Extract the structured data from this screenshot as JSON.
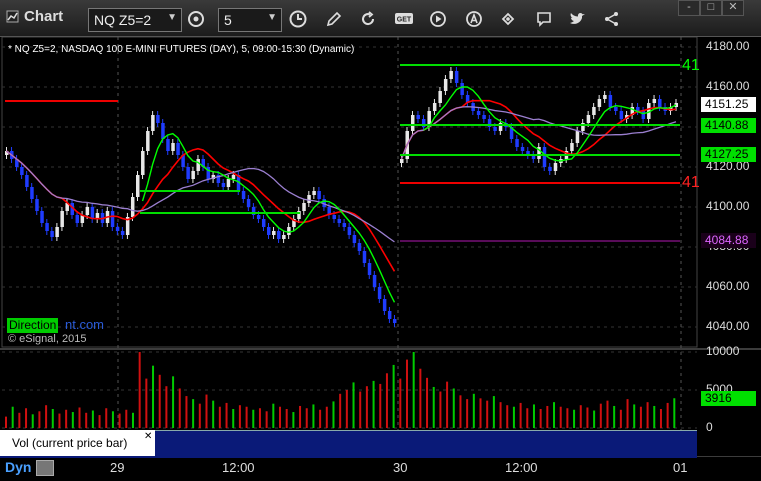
{
  "window": {
    "title": "Chart"
  },
  "toolbar": {
    "symbol": "NQ Z5=2",
    "interval": "5",
    "icons": [
      "settings-icon",
      "clock-icon",
      "draw-pencil-icon",
      "refresh-icon",
      "get-icon",
      "play-icon",
      "font-icon",
      "link-icon",
      "chat-icon",
      "twitter-icon",
      "share-icon"
    ]
  },
  "window_controls": {
    "minimize": "-",
    "maximize": "□",
    "close": "✕"
  },
  "chart_header": "* NQ Z5=2, NASDAQ 100 E-MINI FUTURES (DAY), 5, 09:00-15:30 (Dynamic)",
  "price_axis": [
    "4180.00",
    "4160.00",
    "4140.00",
    "4120.00",
    "4100.00",
    "4080.00",
    "4060.00",
    "4040.00"
  ],
  "price_tags": [
    {
      "text": "4151.25",
      "bg": "#ffffff",
      "fg": "#000000"
    },
    {
      "text": "4140.88",
      "bg": "#00e000",
      "fg": "#000000"
    },
    {
      "text": "4127.25",
      "bg": "#00e000",
      "fg": "#000000"
    },
    {
      "text": "4084.88",
      "bg": "#1a001a",
      "fg": "#dd66ff"
    }
  ],
  "line_labels": [
    {
      "text": "41",
      "color": "#00ff00"
    },
    {
      "text": "41",
      "color": "#ff2020"
    }
  ],
  "volume_axis": [
    "10000",
    "5000",
    "0"
  ],
  "volume_tag": "3916",
  "time_axis": [
    "29",
    "12:00",
    "30",
    "12:00",
    "01"
  ],
  "direction_badge": "Direction",
  "direction_url": "nt.com",
  "copyright": "© eSignal, 2015",
  "volume_study": "Vol (current price bar)",
  "volume_close": "✕",
  "dyn_label": "Dyn",
  "colors": {
    "up": "#e8e8e8",
    "down": "#1f3cff",
    "red_line": "#ff0000",
    "green_line": "#00ff00",
    "purple_line": "#9b7fd0"
  },
  "chart_data": {
    "type": "candlestick",
    "ylim": [
      4030,
      4185
    ],
    "sessions": [
      {
        "label": "29",
        "closes": [
          4128,
          4124,
          4120,
          4116,
          4110,
          4104,
          4098,
          4092,
          4088,
          4085,
          4090,
          4098,
          4102,
          4096,
          4092,
          4096,
          4100,
          4094,
          4097,
          4092,
          4098,
          4090,
          4088,
          4086,
          4095,
          4105,
          4116,
          4128,
          4138,
          4146,
          4142,
          4134,
          4128,
          4132,
          4126,
          4120,
          4114,
          4118,
          4124,
          4120,
          4114,
          4116,
          4112,
          4110,
          4114,
          4116,
          4108,
          4104,
          4100,
          4096,
          4094,
          4090,
          4086,
          4088,
          4084,
          4086,
          4090,
          4094,
          4098,
          4102,
          4106,
          4108,
          4104,
          4100,
          4096,
          4094,
          4092,
          4090,
          4086,
          4082,
          4078,
          4072,
          4066,
          4060,
          4054,
          4048,
          4044,
          4042
        ]
      },
      {
        "label": "30",
        "closes": [
          4124,
          4138,
          4146,
          4144,
          4140,
          4148,
          4152,
          4158,
          4164,
          4168,
          4162,
          4156,
          4152,
          4148,
          4146,
          4144,
          4140,
          4138,
          4142,
          4140,
          4134,
          4130,
          4128,
          4126,
          4124,
          4130,
          4120,
          4118,
          4122,
          4124,
          4128,
          4132,
          4138,
          4142,
          4146,
          4150,
          4154,
          4156,
          4150,
          4148,
          4144,
          4146,
          4150,
          4148,
          4144,
          4152,
          4154,
          4150,
          4148,
          4150,
          4152
        ]
      }
    ],
    "volume": [
      1500,
      2800,
      2000,
      2600,
      1800,
      2200,
      3000,
      2500,
      1900,
      2400,
      2100,
      2700,
      2000,
      2300,
      1700,
      2600,
      2200,
      1900,
      2400,
      2000,
      10000,
      6500,
      8200,
      7000,
      5500,
      6800,
      5200,
      4200,
      3800,
      3200,
      4400,
      3600,
      2800,
      3300,
      2500,
      3000,
      2800,
      2400,
      2600,
      2200,
      3200,
      2800,
      2500,
      2100,
      2900,
      2600,
      3100,
      2400,
      2800,
      3500,
      4500,
      5000,
      6000,
      4800,
      5500,
      6200,
      5800,
      7200,
      8300,
      6500,
      9000,
      10000,
      7800,
      6600,
      5400,
      4800,
      6100,
      5200,
      4300,
      3800,
      4500,
      3900,
      3600,
      4200,
      3400,
      3000,
      2800,
      3300,
      2600,
      3100,
      2500,
      2900,
      3400,
      2800,
      2600,
      2400,
      3000,
      2700,
      2300,
      3200,
      3600,
      2900,
      2400,
      3800,
      3100,
      2800,
      3400,
      2900,
      2500,
      3300,
      3916
    ]
  }
}
